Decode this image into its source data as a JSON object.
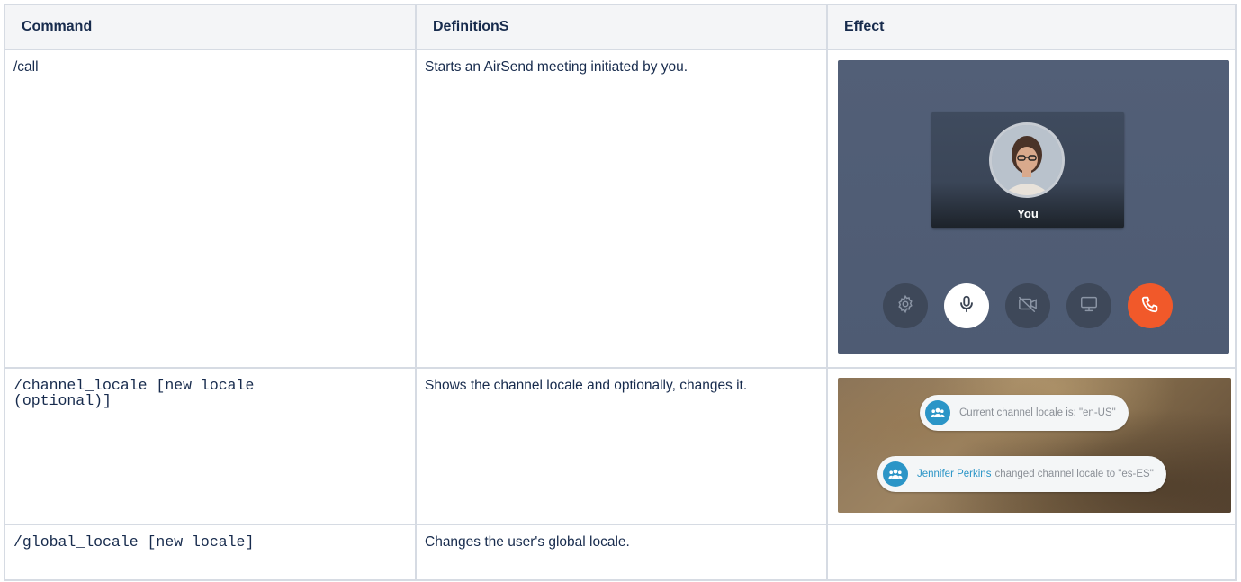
{
  "table": {
    "headers": [
      "Command",
      "DefinitionS",
      "Effect"
    ],
    "rows": [
      {
        "command": "/call",
        "definition": "Starts an AirSend meeting initiated by you.",
        "effect": {
          "type": "call-screenshot",
          "participant_label": "You",
          "controls": [
            "gear-icon",
            "microphone-icon",
            "video-off-icon",
            "screen-share-icon",
            "hang-up-icon"
          ]
        }
      },
      {
        "command": "/channel_locale [new locale (optional)]",
        "definition": "Shows the channel locale and optionally, changes it.",
        "effect": {
          "type": "locale-screenshot",
          "message1": "Current channel locale is: \"en-US\"",
          "message2_user": "Jennifer Perkins",
          "message2_text": "changed channel locale to \"es-ES\""
        }
      },
      {
        "command": "/global_locale [new locale]",
        "definition": "Changes the user's global locale.",
        "effect": null
      }
    ]
  },
  "colors": {
    "header_bg": "#f4f5f7",
    "border": "#d6dbe3",
    "call_bg": "#525f77",
    "hangup": "#f1592a",
    "accent_blue": "#2b95c7"
  }
}
